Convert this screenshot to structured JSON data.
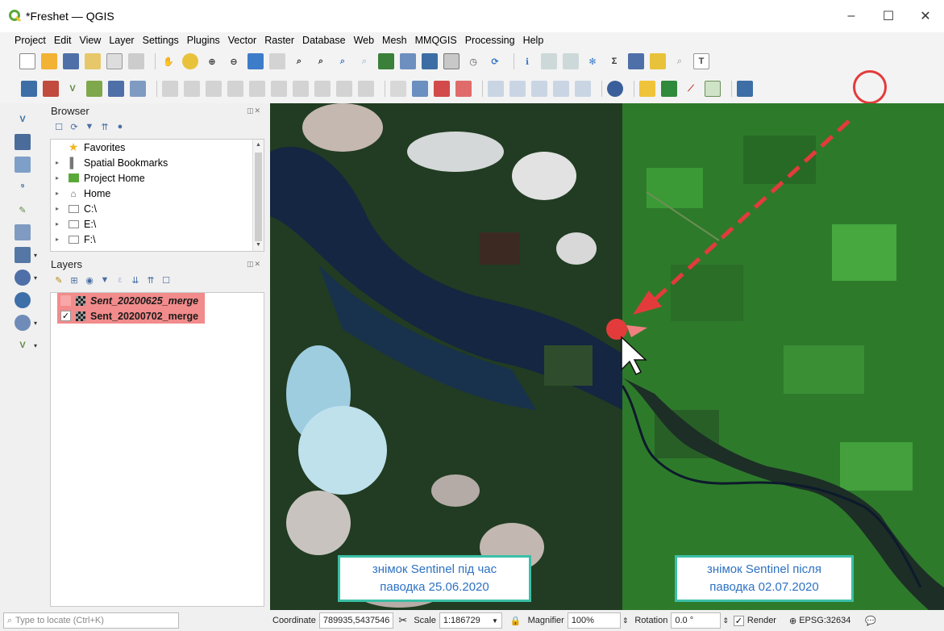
{
  "window": {
    "title": "*Freshet — QGIS",
    "minimize": "–",
    "maximize": "☐",
    "close": "✕"
  },
  "menu": [
    "Project",
    "Edit",
    "View",
    "Layer",
    "Settings",
    "Plugins",
    "Vector",
    "Raster",
    "Database",
    "Web",
    "Mesh",
    "MMQGIS",
    "Processing",
    "Help"
  ],
  "browser": {
    "title": "Browser",
    "items": [
      "Favorites",
      "Spatial Bookmarks",
      "Project Home",
      "Home",
      "C:\\",
      "E:\\",
      "F:\\"
    ]
  },
  "layers": {
    "title": "Layers",
    "items": [
      {
        "name": "Sent_20200625_merge",
        "checked": false
      },
      {
        "name": "Sent_20200702_merge",
        "checked": true
      }
    ]
  },
  "map": {
    "caption_left_line1": "знімок Sentinel під час",
    "caption_left_line2": "паводка 25.06.2020",
    "caption_right_line1": "знімок Sentinel після",
    "caption_right_line2": "паводка 02.07.2020"
  },
  "status": {
    "locate_placeholder": "Type to locate (Ctrl+K)",
    "coordinate_label": "Coordinate",
    "coordinate_value": "789935,5437546",
    "scale_label": "Scale",
    "scale_value": "1:186729",
    "magnifier_label": "Magnifier",
    "magnifier_value": "100%",
    "rotation_label": "Rotation",
    "rotation_value": "0.0 °",
    "render_label": "Render",
    "crs": "EPSG:32634"
  },
  "colors": {
    "highlight": "#e33b3b",
    "layer_highlight": "#f28b8b",
    "caption_border": "#3bbfa7",
    "caption_text": "#2e72c2"
  }
}
